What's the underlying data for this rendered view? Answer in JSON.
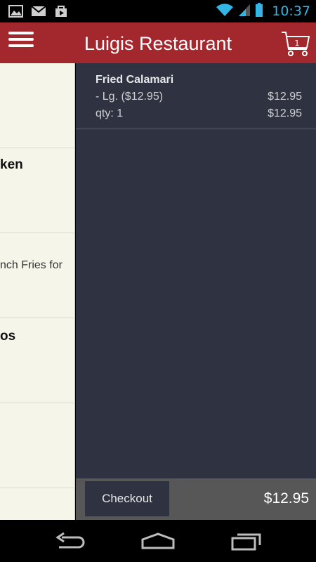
{
  "status_bar": {
    "time": "10:37",
    "icons": [
      "gallery-icon",
      "gmail-icon",
      "play-store-icon",
      "wifi-icon",
      "signal-icon",
      "battery-icon"
    ]
  },
  "app_bar": {
    "title": "Luigis Restaurant",
    "cart_count": "1",
    "menu_icon": "hamburger-menu-icon",
    "cart_icon": "shopping-cart-icon",
    "color": "#a3282e"
  },
  "menu_panel": {
    "rows": [
      {
        "text": ""
      },
      {
        "text": "ken"
      },
      {
        "text": "nch Fries for"
      },
      {
        "text": "os"
      },
      {
        "text": ""
      },
      {
        "text": ""
      }
    ]
  },
  "cart": {
    "items": [
      {
        "name": "Fried Calamari",
        "option_label": "- Lg. ($12.95)",
        "option_price": "$12.95",
        "qty_label": "qty: 1",
        "qty_price": "$12.95"
      }
    ],
    "checkout_label": "Checkout",
    "total": "$12.95"
  },
  "nav_bar": {
    "icons": [
      "back-icon",
      "home-icon",
      "recent-apps-icon"
    ]
  },
  "colors": {
    "app_bar": "#a3282e",
    "cart_bg": "#2e3241",
    "menu_bg": "#f5f5e9",
    "footer_bg": "#575757",
    "clock": "#33b5e5"
  }
}
